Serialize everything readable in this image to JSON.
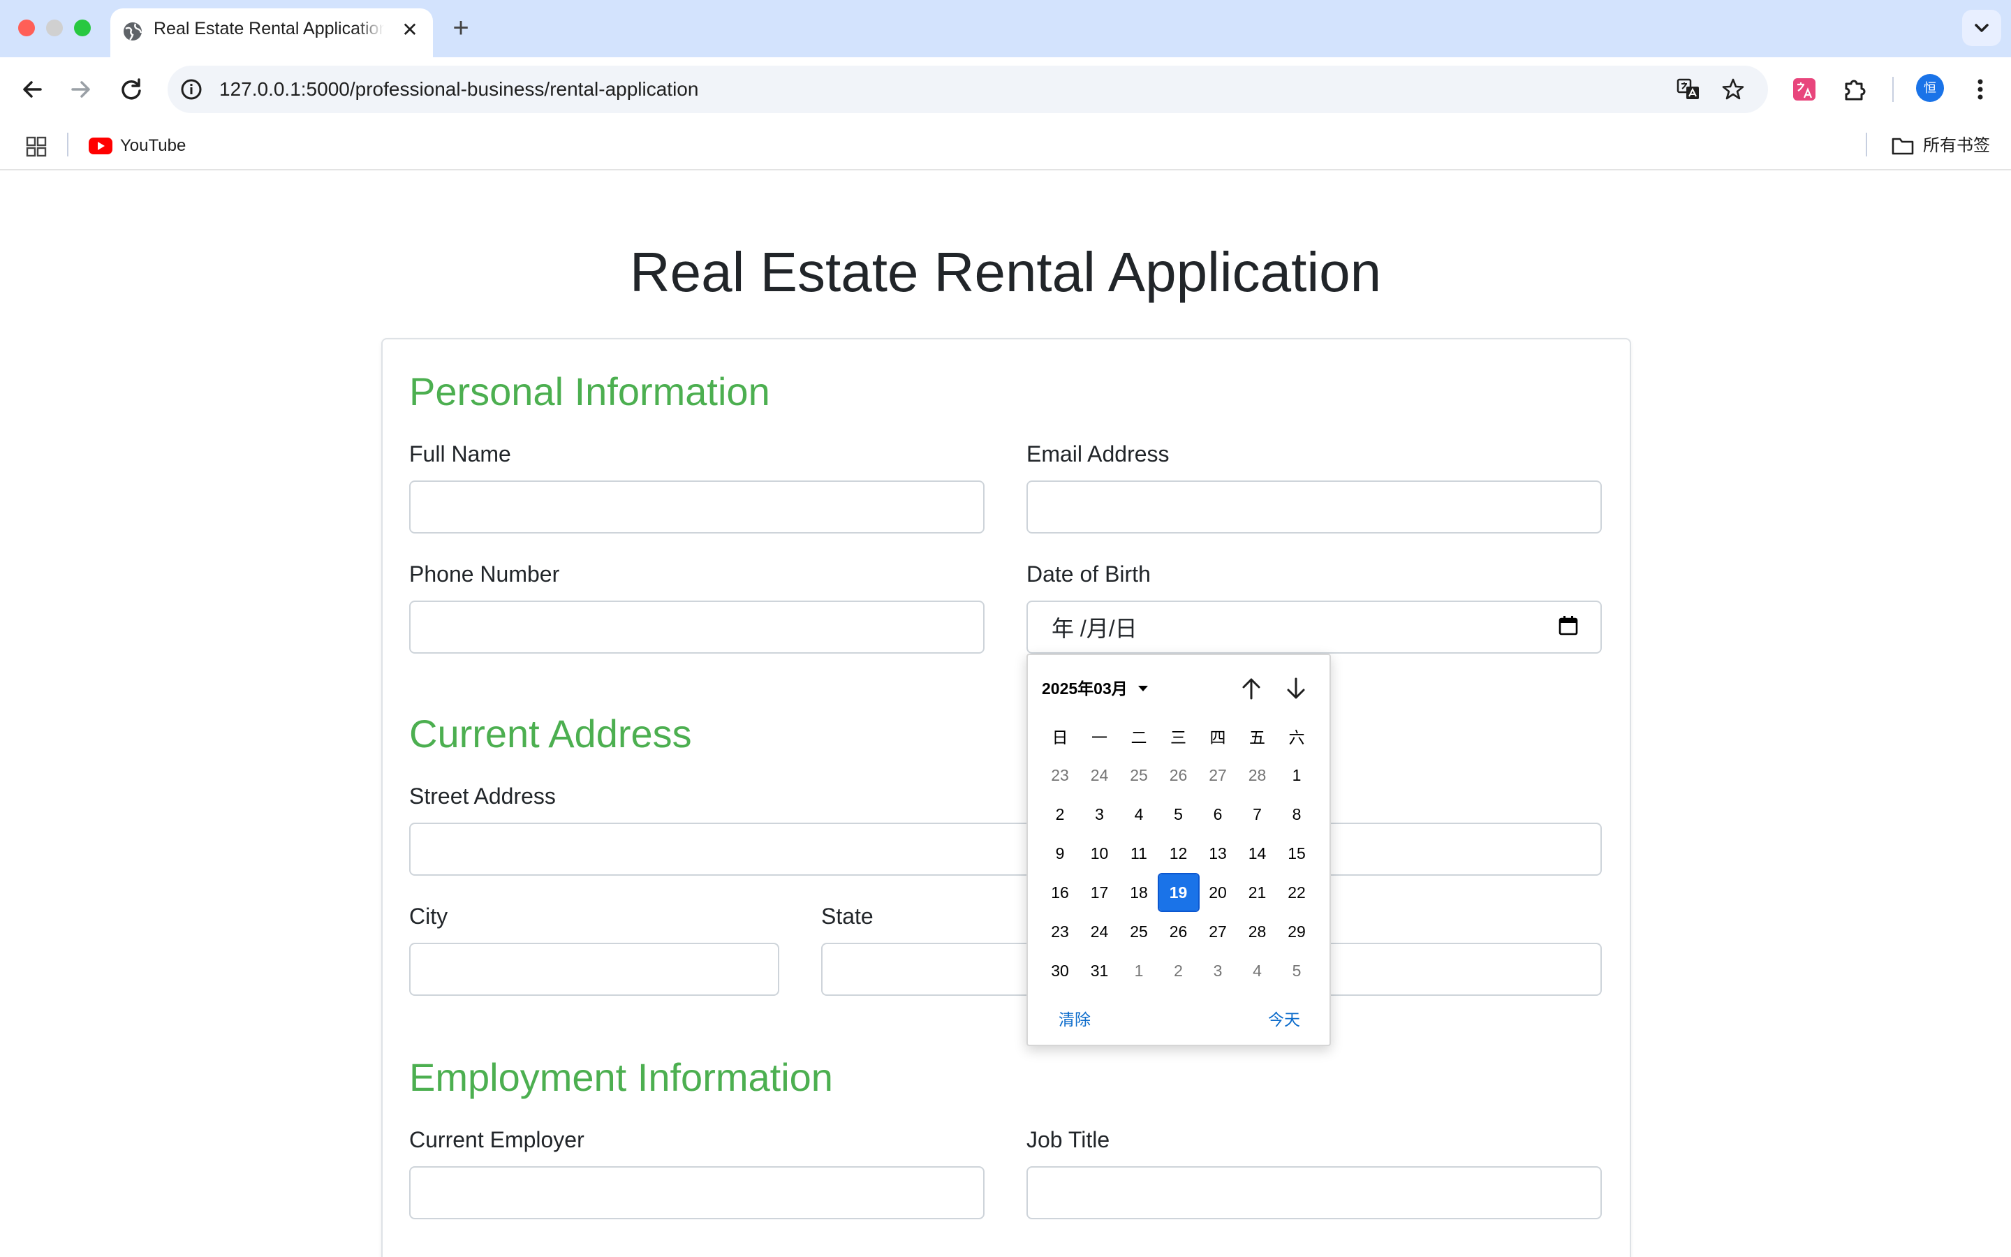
{
  "browser": {
    "tab": {
      "title": "Real Estate Rental Application",
      "close_glyph": "✕"
    },
    "new_tab_glyph": "+",
    "url": "127.0.0.1:5000/professional-business/rental-application",
    "bookmarks": {
      "items": [
        {
          "label": "YouTube",
          "icon": "youtube-icon"
        }
      ],
      "all_bookmarks_label": "所有书签"
    },
    "profile_initial": "恒"
  },
  "page": {
    "title": "Real Estate Rental Application"
  },
  "form": {
    "personal": {
      "heading": "Personal Information",
      "full_name_label": "Full Name",
      "full_name_value": "",
      "email_label": "Email Address",
      "email_value": "",
      "phone_label": "Phone Number",
      "phone_value": "",
      "dob_label": "Date of Birth",
      "dob_display": "年 /月/日"
    },
    "address": {
      "heading": "Current Address",
      "street_label": "Street Address",
      "street_value": "",
      "city_label": "City",
      "city_value": "",
      "state_label": "State",
      "state_value": "",
      "zip_value": ""
    },
    "employment": {
      "heading": "Employment Information",
      "employer_label": "Current Employer",
      "employer_value": "",
      "job_title_label": "Job Title",
      "job_title_value": ""
    }
  },
  "date_picker": {
    "month_label": "2025年03月",
    "weekdays": [
      "日",
      "一",
      "二",
      "三",
      "四",
      "五",
      "六"
    ],
    "weeks": [
      [
        {
          "d": "23",
          "o": true
        },
        {
          "d": "24",
          "o": true
        },
        {
          "d": "25",
          "o": true
        },
        {
          "d": "26",
          "o": true
        },
        {
          "d": "27",
          "o": true
        },
        {
          "d": "28",
          "o": true
        },
        {
          "d": "1",
          "o": false
        }
      ],
      [
        {
          "d": "2",
          "o": false
        },
        {
          "d": "3",
          "o": false
        },
        {
          "d": "4",
          "o": false
        },
        {
          "d": "5",
          "o": false
        },
        {
          "d": "6",
          "o": false
        },
        {
          "d": "7",
          "o": false
        },
        {
          "d": "8",
          "o": false
        }
      ],
      [
        {
          "d": "9",
          "o": false
        },
        {
          "d": "10",
          "o": false
        },
        {
          "d": "11",
          "o": false
        },
        {
          "d": "12",
          "o": false
        },
        {
          "d": "13",
          "o": false
        },
        {
          "d": "14",
          "o": false
        },
        {
          "d": "15",
          "o": false
        }
      ],
      [
        {
          "d": "16",
          "o": false
        },
        {
          "d": "17",
          "o": false
        },
        {
          "d": "18",
          "o": false
        },
        {
          "d": "19",
          "o": false
        },
        {
          "d": "20",
          "o": false
        },
        {
          "d": "21",
          "o": false
        },
        {
          "d": "22",
          "o": false
        }
      ],
      [
        {
          "d": "23",
          "o": false
        },
        {
          "d": "24",
          "o": false
        },
        {
          "d": "25",
          "o": false
        },
        {
          "d": "26",
          "o": false
        },
        {
          "d": "27",
          "o": false
        },
        {
          "d": "28",
          "o": false
        },
        {
          "d": "29",
          "o": false
        }
      ],
      [
        {
          "d": "30",
          "o": false
        },
        {
          "d": "31",
          "o": false
        },
        {
          "d": "1",
          "o": true
        },
        {
          "d": "2",
          "o": true
        },
        {
          "d": "3",
          "o": true
        },
        {
          "d": "4",
          "o": true
        },
        {
          "d": "5",
          "o": true
        }
      ]
    ],
    "selected_day": "19",
    "clear_label": "清除",
    "today_label": "今天"
  },
  "colors": {
    "section_heading": "#4caf50",
    "selected_day_bg": "#1a73e8",
    "link": "#0b6bcb",
    "tab_strip": "#d3e3fd"
  }
}
